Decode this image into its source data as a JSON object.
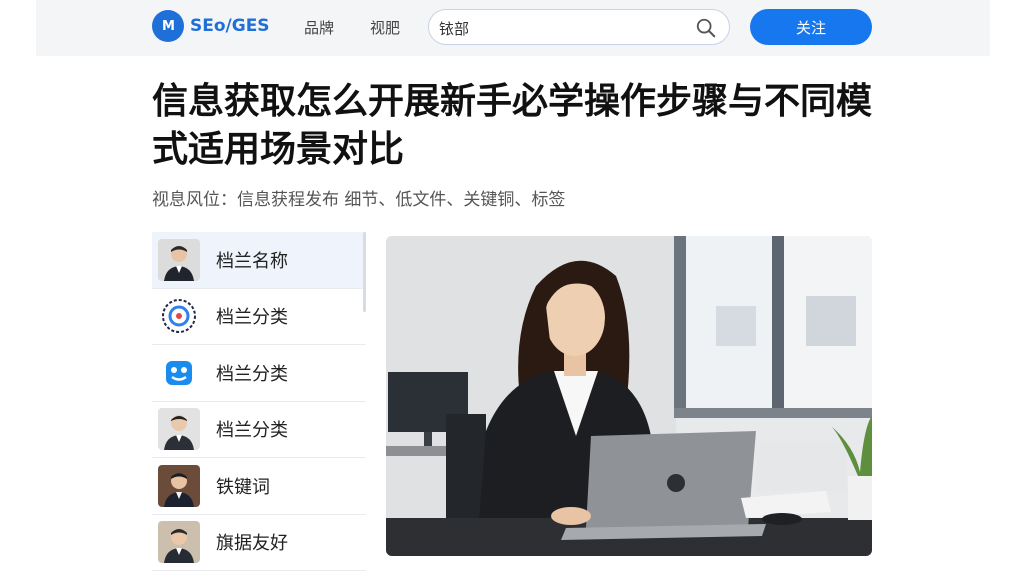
{
  "header": {
    "logo_text": "SEo/GES",
    "logo_mark": "M",
    "nav": [
      "品牌",
      "视肥"
    ],
    "search_value": "铱部",
    "follow_label": "关注"
  },
  "article": {
    "title": "信息获取怎么开展新手必学操作步骤与不同模式适用场景对比",
    "meta": "视息风位：信息获程发布  细节、低文件、关键铜、标签"
  },
  "sidebar": {
    "items": [
      {
        "label": "档兰名称",
        "icon": "person-avatar"
      },
      {
        "label": "档兰分类",
        "icon": "circular-badge-icon"
      },
      {
        "label": "档兰分类",
        "icon": "blue-face-icon"
      },
      {
        "label": "档兰分类",
        "icon": "person-avatar"
      },
      {
        "label": "铁键词",
        "icon": "person-avatar"
      },
      {
        "label": "旗据友好",
        "icon": "person-avatar"
      }
    ]
  },
  "colors": {
    "brand": "#1f6fd8",
    "button": "#1777ef",
    "active_row": "#eef3fc"
  }
}
